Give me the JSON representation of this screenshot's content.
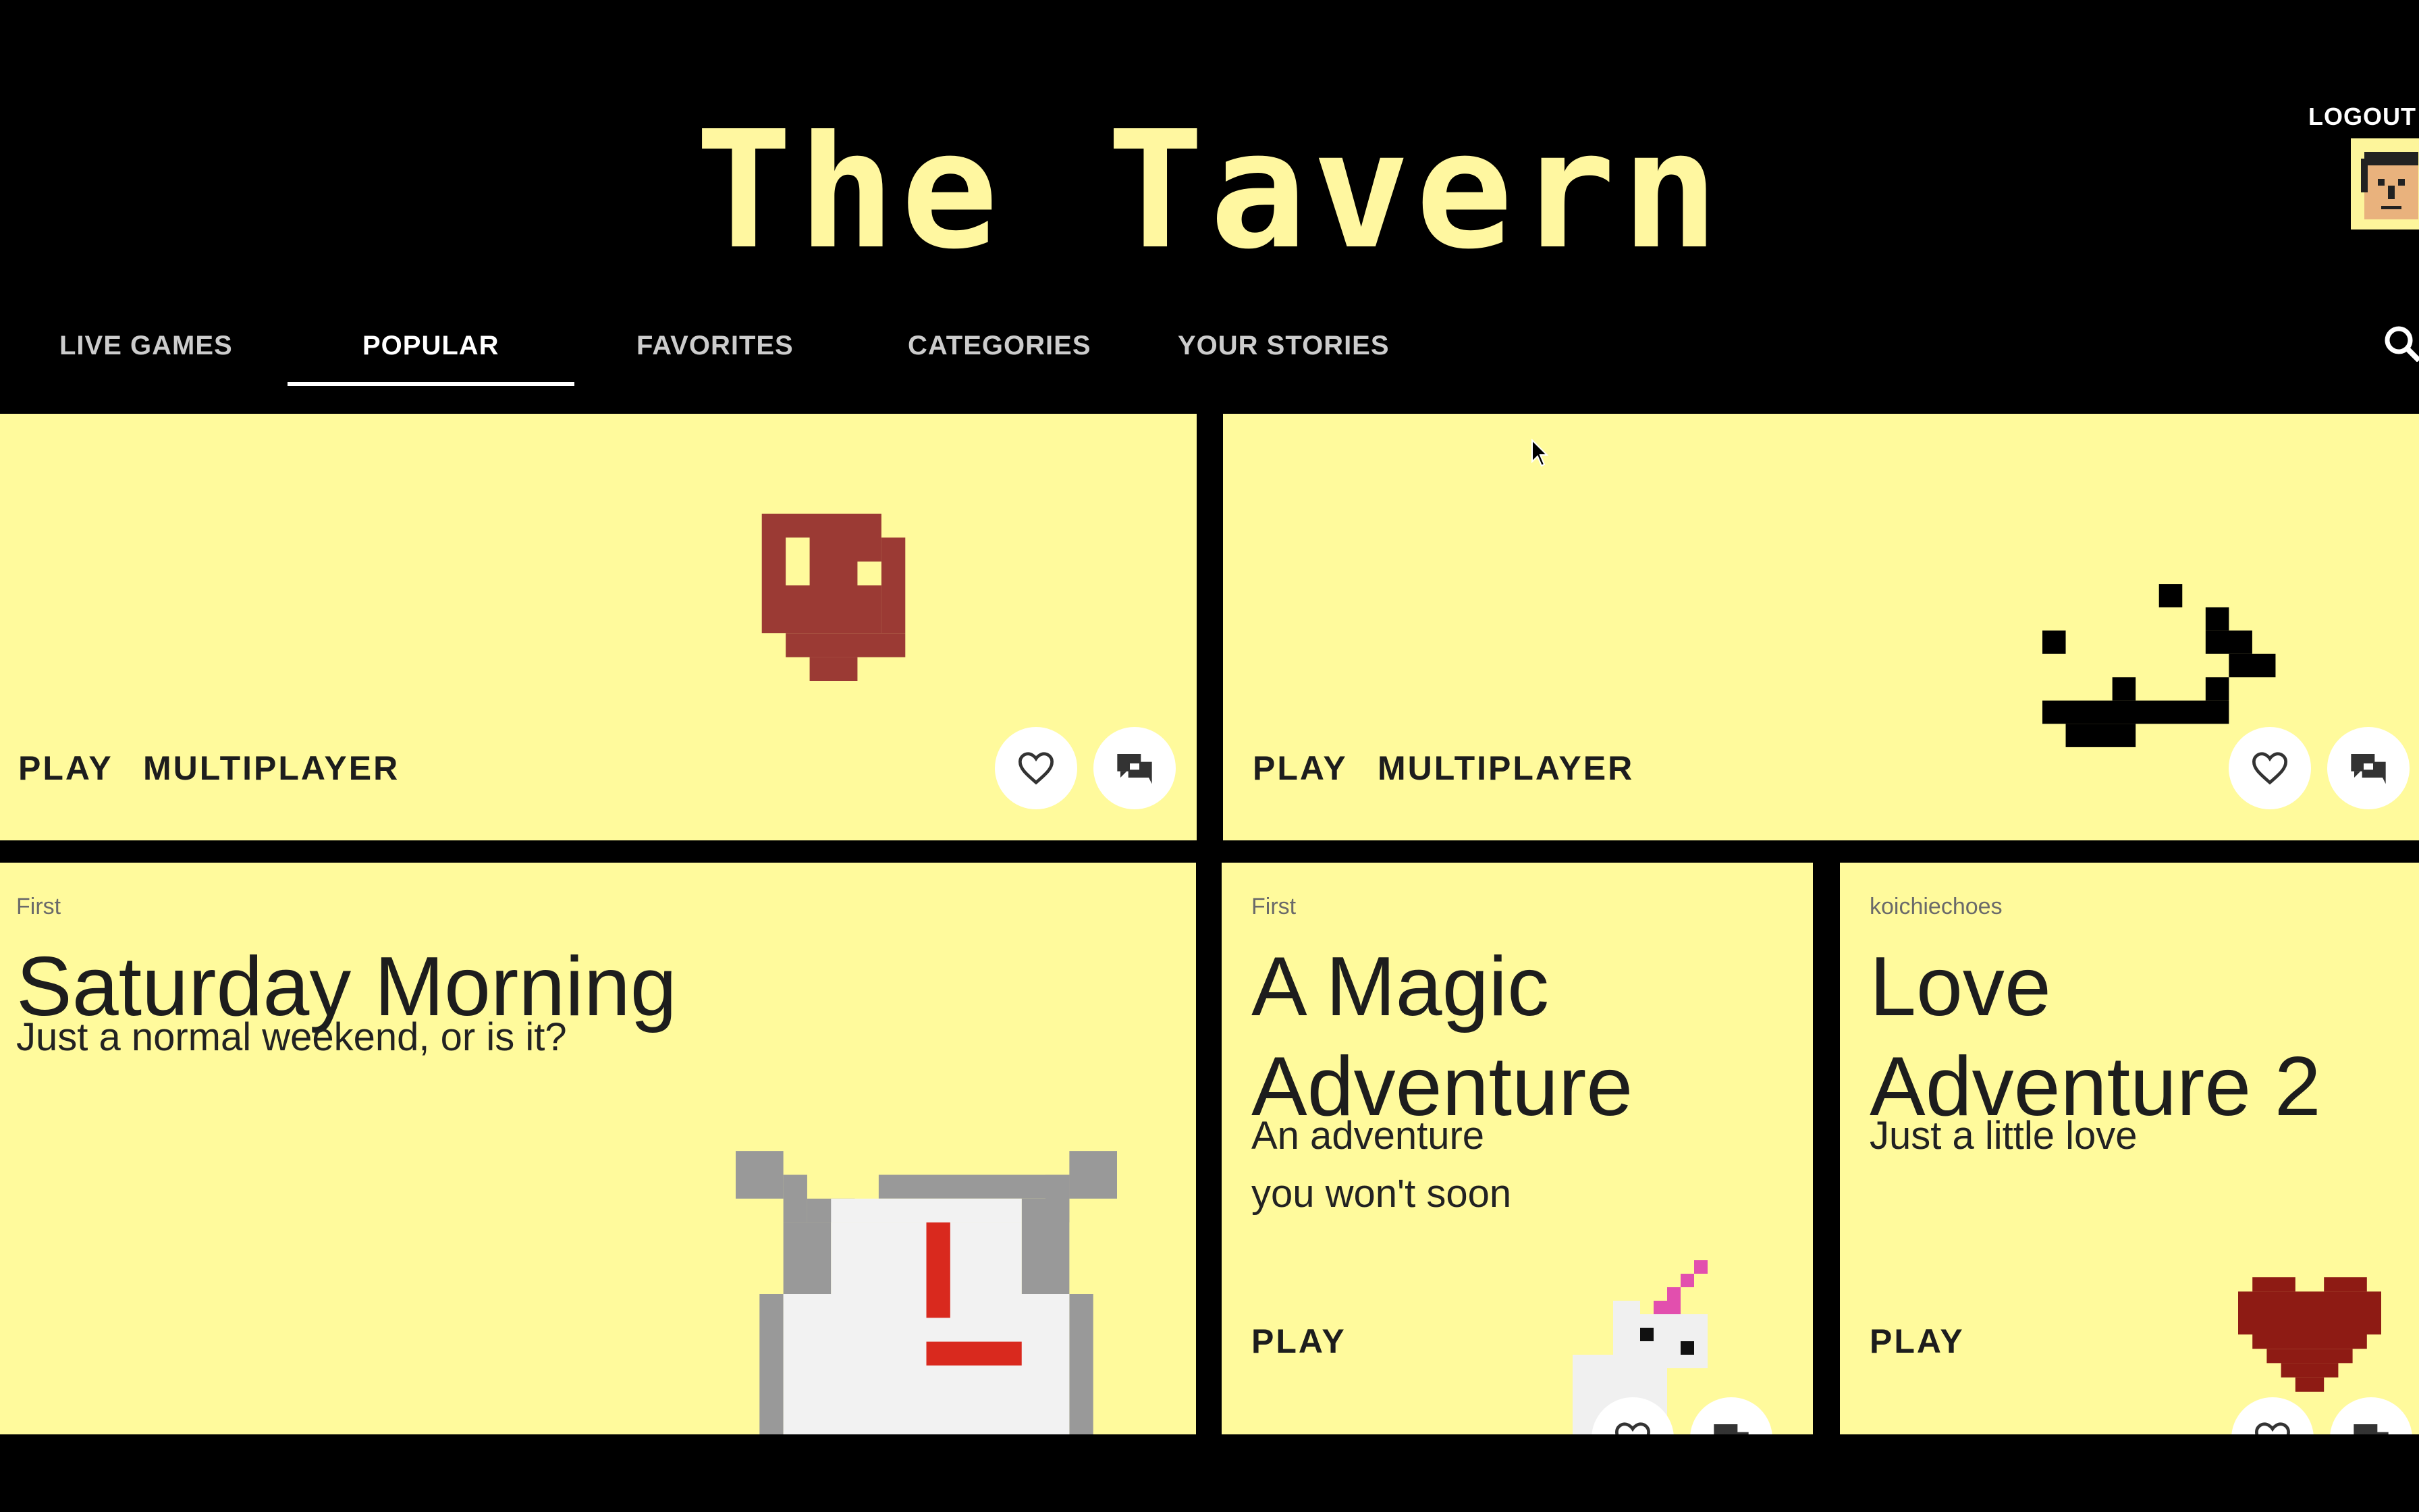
{
  "app": {
    "title": "The Tavern",
    "logout_label": "LOGOUT"
  },
  "nav": {
    "tabs": [
      {
        "label": "LIVE GAMES"
      },
      {
        "label": "POPULAR",
        "active": true
      },
      {
        "label": "FAVORITES"
      },
      {
        "label": "CATEGORIES"
      },
      {
        "label": "YOUR STORIES"
      }
    ]
  },
  "cards_top": [
    {
      "play_label": "PLAY",
      "multiplayer_label": "MULTIPLAYER"
    },
    {
      "play_label": "PLAY",
      "multiplayer_label": "MULTIPLAYER"
    }
  ],
  "stories": [
    {
      "author": "First",
      "title": "Saturday Morning",
      "subtitle": "Just a normal weekend, or is it?"
    },
    {
      "author": "First",
      "title_line1": "A Magic",
      "title_line2": "Adventure",
      "subtitle_line1": "An adventure",
      "subtitle_line2": "you won't soon",
      "play_label": "PLAY"
    },
    {
      "author": "koichiechoes",
      "title_line1": "Love",
      "title_line2": "Adventure 2",
      "subtitle": "Just a little love",
      "play_label": "PLAY"
    }
  ],
  "colors": {
    "card_bg": "#fffa9c",
    "title_yellow": "#fff7a0",
    "accent_red": "#9b3a34",
    "heart_red": "#8e1b14"
  }
}
